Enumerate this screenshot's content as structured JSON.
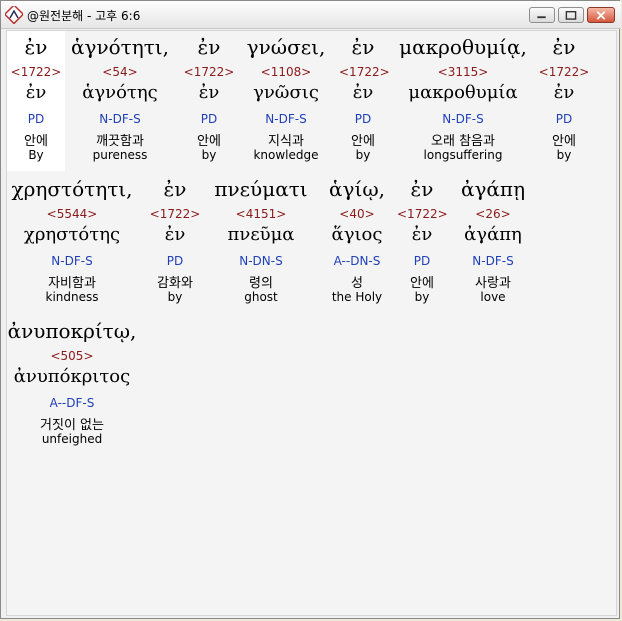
{
  "window": {
    "title": "@원전분해 - 고후 6:6"
  },
  "words": [
    {
      "greek": "ἐν",
      "strong": "<1722>",
      "lemma": "ἐν",
      "morph": "PD",
      "korean": "안에",
      "english": "By"
    },
    {
      "greek": "ἁγνότητι,",
      "strong": "<54>",
      "lemma": "ἁγνότης",
      "morph": "N-DF-S",
      "korean": "깨끗함과",
      "english": "pureness"
    },
    {
      "greek": "ἐν",
      "strong": "<1722>",
      "lemma": "ἐν",
      "morph": "PD",
      "korean": "안에",
      "english": "by"
    },
    {
      "greek": "γνώσει,",
      "strong": "<1108>",
      "lemma": "γνῶσις",
      "morph": "N-DF-S",
      "korean": "지식과",
      "english": "knowledge"
    },
    {
      "greek": "ἐν",
      "strong": "<1722>",
      "lemma": "ἐν",
      "morph": "PD",
      "korean": "안에",
      "english": "by"
    },
    {
      "greek": "μακροθυμίᾳ,",
      "strong": "<3115>",
      "lemma": "μακροθυμία",
      "morph": "N-DF-S",
      "korean": "오래 참음과",
      "english": "longsuffering"
    },
    {
      "greek": "ἐν",
      "strong": "<1722>",
      "lemma": "ἐν",
      "morph": "PD",
      "korean": "안에",
      "english": "by"
    },
    {
      "greek": "χρηστότητι,",
      "strong": "<5544>",
      "lemma": "χρηστότης",
      "morph": "N-DF-S",
      "korean": "자비함과",
      "english": "kindness"
    },
    {
      "greek": "ἐν",
      "strong": "<1722>",
      "lemma": "ἐν",
      "morph": "PD",
      "korean": "감화와",
      "english": "by"
    },
    {
      "greek": "πνεύματι",
      "strong": "<4151>",
      "lemma": "πνεῦμα",
      "morph": "N-DN-S",
      "korean": "령의",
      "english": "ghost"
    },
    {
      "greek": "ἁγίῳ,",
      "strong": "<40>",
      "lemma": "ἅγιος",
      "morph": "A--DN-S",
      "korean": "성",
      "english": "the Holy"
    },
    {
      "greek": "ἐν",
      "strong": "<1722>",
      "lemma": "ἐν",
      "morph": "PD",
      "korean": "안에",
      "english": "by"
    },
    {
      "greek": "ἀγάπῃ",
      "strong": "<26>",
      "lemma": "ἀγάπη",
      "morph": "N-DF-S",
      "korean": "사랑과",
      "english": "love"
    },
    {
      "greek": "ἀνυποκρίτῳ,",
      "strong": "<505>",
      "lemma": "ἀνυπόκριτος",
      "morph": "A--DF-S",
      "korean": "거짓이 없는",
      "english": "unfeighed"
    }
  ]
}
